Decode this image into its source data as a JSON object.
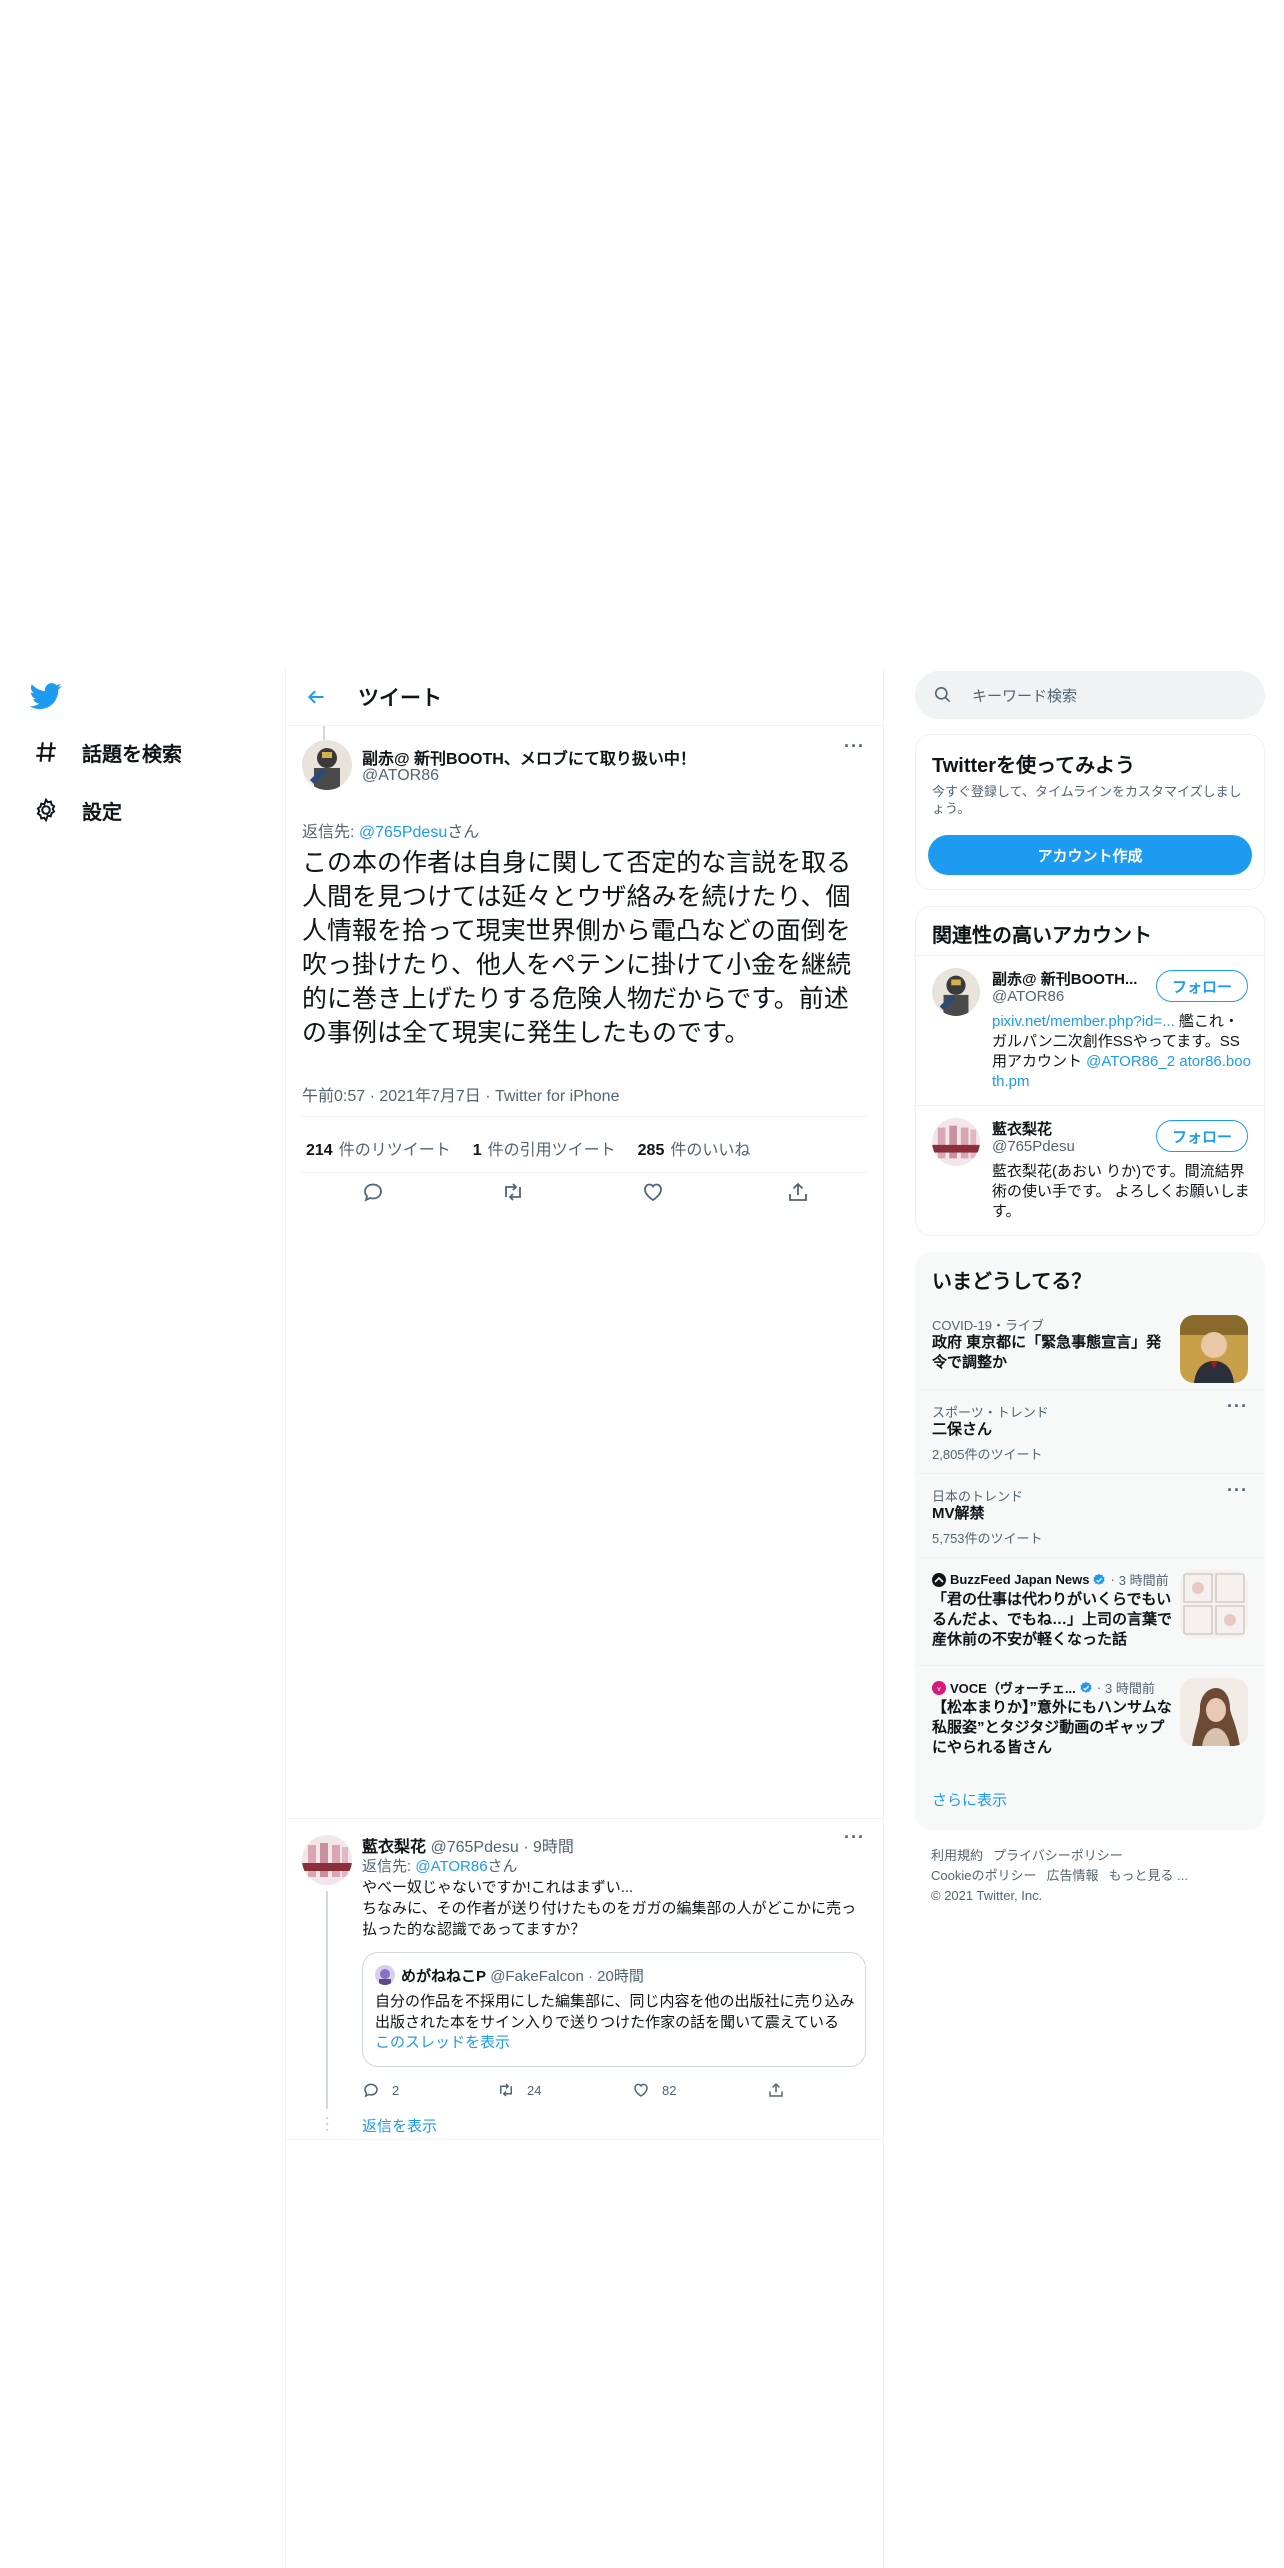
{
  "nav": {
    "logo": "twitter-bird",
    "explore_label": "話題を検索",
    "settings_label": "設定"
  },
  "header": {
    "title": "ツイート"
  },
  "tweet": {
    "name": "副赤@ 新刊BOOTH、メロブにて取り扱い中！",
    "handle": "@ATOR86",
    "reply_prefix": "返信先: ",
    "reply_to": "@765Pdesu",
    "reply_suffix": "さん",
    "text": "この本の作者は自身に関して否定的な言説を取る人間を見つけては延々とウザ絡みを続けたり、個人情報を拾って現実世界側から電凸などの面倒を吹っ掛けたり、他人をペテンに掛けて小金を継続的に巻き上げたりする危険人物だからです。前述の事例は全て現実に発生したものです。",
    "meta": "午前0:57 · 2021年7月7日 · Twitter for iPhone",
    "retweets": "214",
    "retweets_label": "件のリツイート",
    "quotes": "1",
    "quotes_label": "件の引用ツイート",
    "likes": "285",
    "likes_label": "件のいいね"
  },
  "reply": {
    "name": "藍衣梨花",
    "handle": "@765Pdesu",
    "time": "9時間",
    "reply_prefix": "返信先: ",
    "reply_to": "@ATOR86",
    "reply_suffix": "さん",
    "text_line1": "やべー奴じゃないですか!これはまずい...",
    "text_line2": "ちなみに、その作者が送り付けたものをガガの編集部の人がどこかに売っ払った的な認識であってますか？",
    "quote": {
      "name": "めがねねこP",
      "handle": "@FakeFalcon",
      "time": "20時間",
      "text": "自分の作品を不採用にした編集部に、同じ内容を他の出版社に売り込み出版された本をサイン入りで送りつけた作家の話を聞いて震えている",
      "thread_link": "このスレッドを表示"
    },
    "reply_count": "2",
    "retweet_count": "24",
    "like_count": "82",
    "show_replies": "返信を表示"
  },
  "sidebar": {
    "search_placeholder": "キーワード検索",
    "signup": {
      "title": "Twitterを使ってみよう",
      "desc": "今すぐ登録して、タイムラインをカスタマイズしましょう。",
      "button": "アカウント作成"
    },
    "related": {
      "title": "関連性の高いアカウント",
      "accounts": [
        {
          "name": "副赤@ 新刊BOOTH...",
          "handle": "@ATOR86",
          "bio_link1": "pixiv.net/member.php?id=...",
          "bio_text": " 艦これ・ガルパン二次創作SSやってます。SS用アカウント ",
          "bio_link2": "@ATOR86_2",
          "bio_link3": "ator86.booth.pm",
          "follow": "フォロー"
        },
        {
          "name": "藍衣梨花",
          "handle": "@765Pdesu",
          "bio_text": "藍衣梨花(あおい りか)です。間流結界術の使い手です。 よろしくお願いします。",
          "follow": "フォロー"
        }
      ]
    },
    "trends": {
      "title": "いまどうしてる？",
      "items": [
        {
          "context": "COVID-19・ライブ",
          "title": "政府 東京都に「緊急事態宣言」発令で調整か"
        },
        {
          "context": "スポーツ・トレンド",
          "title": "二保さん",
          "count": "2,805件のツイート"
        },
        {
          "context": "日本のトレンド",
          "title": "MV解禁",
          "count": "5,753件のツイート"
        },
        {
          "source": "BuzzFeed Japan News",
          "time": "3 時間前",
          "title": "「君の仕事は代わりがいくらでもいるんだよ、でもね…」上司の言葉で産休前の不安が軽くなった話"
        },
        {
          "source": "VOCE（ヴォーチェ...",
          "time": "3 時間前",
          "title": "【松本まりか】”意外にもハンサムな私服姿”とタジタジ動画のギャップにやられる皆さん"
        }
      ],
      "show_more": "さらに表示"
    },
    "footer": {
      "terms": "利用規約",
      "privacy": "プライバシーポリシー",
      "cookie": "Cookieのポリシー",
      "ads": "広告情報",
      "more": "もっと見る ...",
      "copyright": "© 2021 Twitter, Inc."
    }
  },
  "colors": {
    "accent": "#1d9bf0",
    "text": "#0f1419",
    "secondary": "#536471",
    "border": "#eff3f4"
  }
}
